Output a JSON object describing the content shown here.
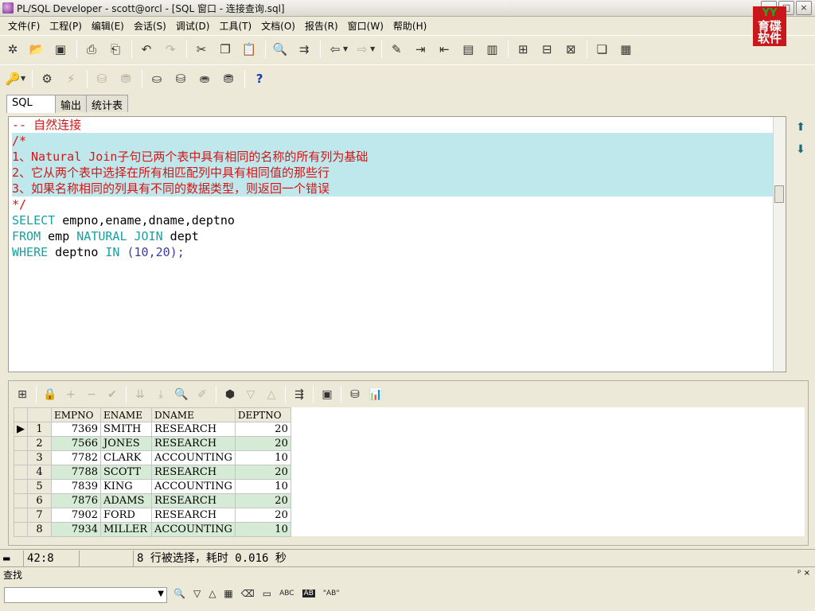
{
  "window": {
    "title": "PL/SQL Developer - scott@orcl - [SQL 窗口 - 连接查询.sql]",
    "controls": [
      "_",
      "□",
      "×"
    ]
  },
  "logo": {
    "line1": "YY",
    "line2": "育碟",
    "line3": "软件"
  },
  "menu": [
    "文件(F)",
    "工程(P)",
    "编辑(E)",
    "会话(S)",
    "调试(D)",
    "工具(T)",
    "文档(O)",
    "报告(R)",
    "窗口(W)",
    "帮助(H)"
  ],
  "tabs": [
    "SQL",
    "输出",
    "统计表"
  ],
  "editor": {
    "lines": [
      "-- 自然连接",
      "/*",
      "1、Natural Join子句已两个表中具有相同的名称的所有列为基础",
      "2、它从两个表中选择在所有相匹配列中具有相同值的那些行",
      "3、如果名称相同的列具有不同的数据类型，则返回一个错误",
      "*/"
    ],
    "sql1": {
      "kw": "SELECT",
      "rest": " empno,ename,dname,deptno"
    },
    "sql2": {
      "kw1": "FROM",
      "mid": " emp ",
      "kw2": "NATURAL JOIN",
      "rest": " dept"
    },
    "sql3": {
      "kw1": "WHERE",
      "mid": " deptno ",
      "kw2": "IN",
      "rest": " (10,20);"
    }
  },
  "grid": {
    "columns": [
      "EMPNO",
      "ENAME",
      "DNAME",
      "DEPTNO"
    ],
    "rows": [
      [
        "1",
        "7369",
        "SMITH",
        "RESEARCH",
        "20"
      ],
      [
        "2",
        "7566",
        "JONES",
        "RESEARCH",
        "20"
      ],
      [
        "3",
        "7782",
        "CLARK",
        "ACCOUNTING",
        "10"
      ],
      [
        "4",
        "7788",
        "SCOTT",
        "RESEARCH",
        "20"
      ],
      [
        "5",
        "7839",
        "KING",
        "ACCOUNTING",
        "10"
      ],
      [
        "6",
        "7876",
        "ADAMS",
        "RESEARCH",
        "20"
      ],
      [
        "7",
        "7902",
        "FORD",
        "RESEARCH",
        "20"
      ],
      [
        "8",
        "7934",
        "MILLER",
        "ACCOUNTING",
        "10"
      ]
    ]
  },
  "status": {
    "position": "42:8",
    "message": "8 行被选择，耗时 0.016 秒"
  },
  "find": {
    "title": "查找",
    "pin": "ᵖ ×",
    "abc": "ABC",
    "ab": "\"AB\""
  }
}
